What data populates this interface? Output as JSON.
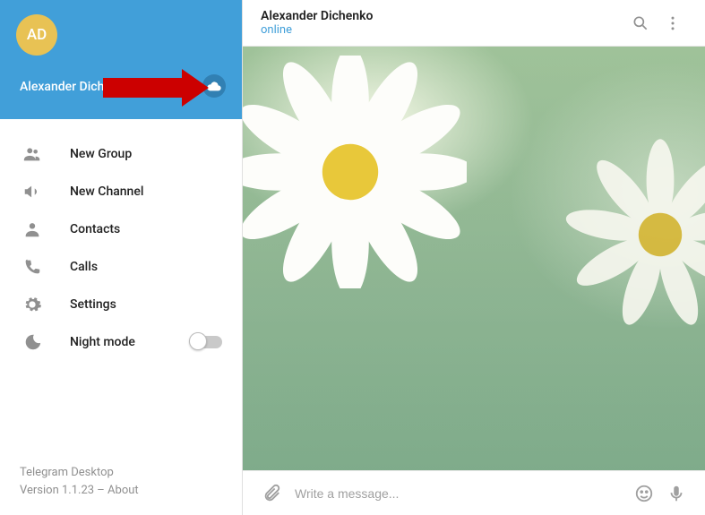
{
  "sidebar": {
    "avatar_initials": "AD",
    "username": "Alexander Dichenko",
    "menu": [
      {
        "icon": "group-icon",
        "label": "New Group"
      },
      {
        "icon": "channel-icon",
        "label": "New Channel"
      },
      {
        "icon": "contacts-icon",
        "label": "Contacts"
      },
      {
        "icon": "calls-icon",
        "label": "Calls"
      },
      {
        "icon": "settings-icon",
        "label": "Settings"
      },
      {
        "icon": "night-mode-icon",
        "label": "Night mode"
      }
    ],
    "footer": {
      "app_name": "Telegram Desktop",
      "version_prefix": "Version 1.1.23 – ",
      "about_label": "About"
    }
  },
  "chat": {
    "title": "Alexander Dichenko",
    "status": "online",
    "input_placeholder": "Write a message..."
  },
  "colors": {
    "header_bg": "#419fd9",
    "accent": "#419fd9",
    "avatar_bg": "#e8c254"
  }
}
